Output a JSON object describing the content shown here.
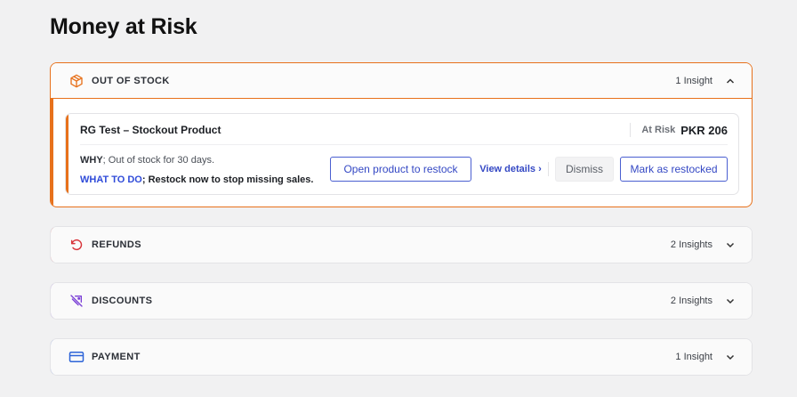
{
  "page": {
    "title": "Money at Risk"
  },
  "colors": {
    "out_of_stock": "#e7711b",
    "refunds": "#d8343a",
    "discounts": "#7a3fd6",
    "payment": "#2d64d8",
    "link": "#3448c4"
  },
  "sections": {
    "out_of_stock": {
      "title": "OUT OF STOCK",
      "count": "1 Insight",
      "icon": "box-icon",
      "expanded": true,
      "insight": {
        "title": "RG Test – Stockout Product",
        "risk_label": "At Risk",
        "risk_value": "PKR 206",
        "why_label": "WHY",
        "why_text": "; Out of stock for 30 days.",
        "todo_label": "WHAT TO DO",
        "todo_text": "; Restock now to stop missing sales.",
        "actions": {
          "open_product": "Open product to restock",
          "view_details": "View details ›",
          "dismiss": "Dismiss",
          "mark_restocked": "Mark as restocked"
        }
      }
    },
    "refunds": {
      "title": "REFUNDS",
      "count": "2 Insights",
      "icon": "undo-icon",
      "expanded": false
    },
    "discounts": {
      "title": "DISCOUNTS",
      "count": "2 Insights",
      "icon": "tag-slash-icon",
      "expanded": false
    },
    "payment": {
      "title": "PAYMENT",
      "count": "1 Insight",
      "icon": "credit-card-icon",
      "expanded": false
    }
  }
}
